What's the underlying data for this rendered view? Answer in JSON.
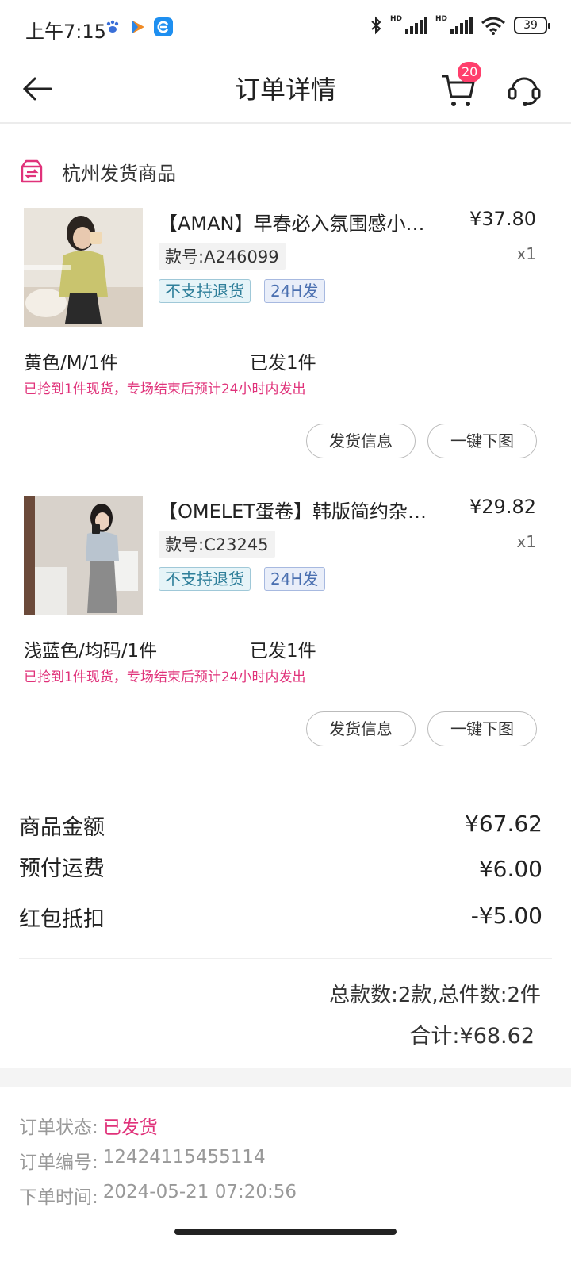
{
  "status_bar": {
    "time": "上午7:15",
    "hd_1": "HD",
    "hd_2": "HD",
    "battery": "39"
  },
  "nav": {
    "title": "订单详情",
    "cart_count": "20"
  },
  "section": {
    "title": "杭州发货商品"
  },
  "products": [
    {
      "title": "【AMAN】早春必入氛围感小…",
      "price": "¥37.80",
      "qty": "x1",
      "code": "款号:A246099",
      "tags": [
        "不支持退货",
        "24H发"
      ],
      "spec": "黄色/M/1件",
      "shipped": "已发1件",
      "note": "已抢到1件现货，专场结束后预计24小时内发出",
      "btn_info": "发货信息",
      "btn_download": "一键下图"
    },
    {
      "title": "【OMELET蛋卷】韩版简约杂…",
      "price": "¥29.82",
      "qty": "x1",
      "code": "款号:C23245",
      "tags": [
        "不支持退货",
        "24H发"
      ],
      "spec": "浅蓝色/均码/1件",
      "shipped": "已发1件",
      "note": "已抢到1件现货，专场结束后预计24小时内发出",
      "btn_info": "发货信息",
      "btn_download": "一键下图"
    }
  ],
  "amounts": {
    "goods_label": "商品金额",
    "goods_value": "¥67.62",
    "shipping_label": "预付运费",
    "shipping_value": "¥6.00",
    "redpacket_label": "红包抵扣",
    "redpacket_value": "-¥5.00",
    "count_summary": "总款数:2款,总件数:2件",
    "total": "合计:¥68.62"
  },
  "order_info": {
    "status_label": "订单状态:",
    "status_value": "已发货",
    "number_label": "订单编号:",
    "number_value": "12424115455114",
    "time_label": "下单时间:",
    "time_value": "2024-05-21 07:20:56"
  },
  "colors": {
    "accent_pink": "#e0327a",
    "badge_red": "#ff3f6c"
  }
}
